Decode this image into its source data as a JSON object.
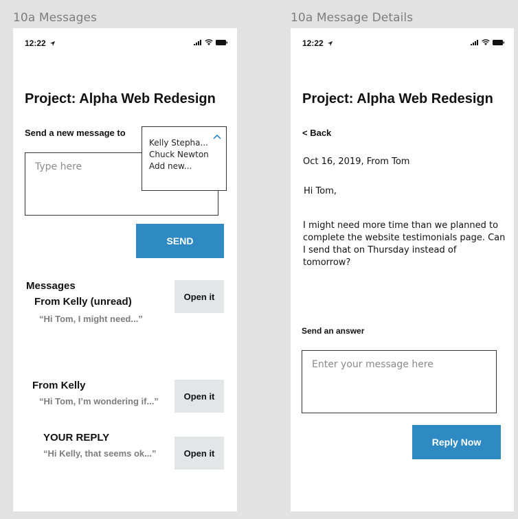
{
  "left": {
    "artboard_title": "10a Messages",
    "status_time": "12:22",
    "project_title": "Project: Alpha Web Redesign",
    "send_label": "Send a new message to",
    "recipients": [
      "Kelly Stepha...",
      "Chuck Newton",
      "Add new..."
    ],
    "message_placeholder": "Type here",
    "send_button": "SEND",
    "messages_heading": "Messages",
    "messages": [
      {
        "from": "From Kelly (unread)",
        "preview": "“Hi Tom, I might need...”",
        "action": "Open it"
      },
      {
        "from": "From Kelly",
        "preview": "“Hi Tom, I’m wondering if...”",
        "action": "Open it"
      },
      {
        "from": "YOUR REPLY",
        "preview": "“Hi Kelly, that seems ok...”",
        "action": "Open it"
      }
    ]
  },
  "right": {
    "artboard_title": "10a Message Details",
    "status_time": "12:22",
    "project_title": "Project: Alpha Web Redesign",
    "back_label": "< Back",
    "meta": "Oct 16, 2019, From Tom",
    "greeting": "Hi Tom,",
    "body": "I might need more time than we planned to complete the website testimonials page. Can I send that on Thursday instead of tomorrow?",
    "answer_label": "Send an answer",
    "answer_placeholder": "Enter your message here",
    "reply_button": "Reply Now"
  },
  "icons": {
    "status": [
      "location-arrow-icon",
      "signal-icon",
      "wifi-icon",
      "battery-icon"
    ],
    "dropdown": "chevron-up-icon"
  },
  "colors": {
    "background": "#e2e2e2",
    "primary": "#2f8ac3",
    "secondary_button": "#e2e6e6",
    "muted_text": "#7d7d7d"
  }
}
